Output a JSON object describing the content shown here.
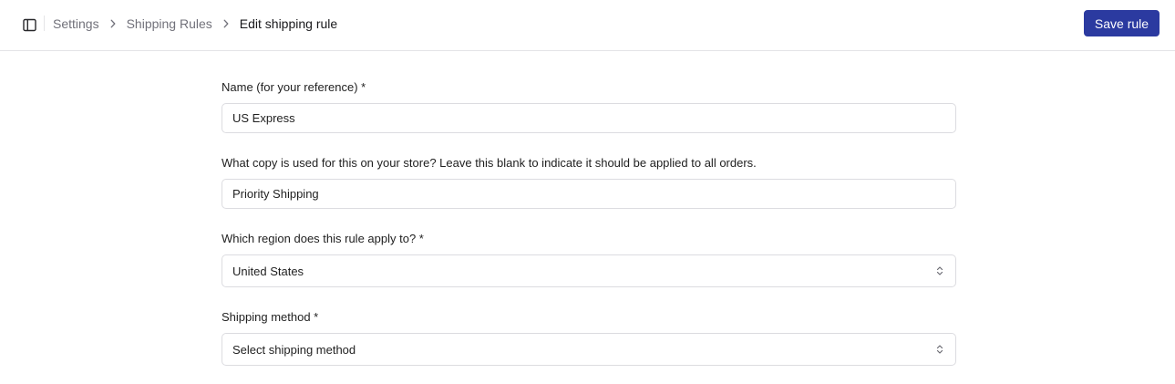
{
  "icons": {
    "sidebar_toggle": "sidebar-panel-icon",
    "breadcrumb_separator": "chevron-right-icon",
    "select_indicator": "chevron-up-down-icon"
  },
  "colors": {
    "primary": "#2b3aa0",
    "border": "#dcdce0",
    "muted_text": "#71717a"
  },
  "breadcrumb": {
    "items": [
      "Settings",
      "Shipping Rules"
    ],
    "current": "Edit shipping rule"
  },
  "header": {
    "save_label": "Save rule"
  },
  "form": {
    "name": {
      "label": "Name (for your reference) *",
      "value": "US Express"
    },
    "copy": {
      "label": "What copy is used for this on your store? Leave this blank to indicate it should be applied to all orders.",
      "value": "Priority Shipping"
    },
    "region": {
      "label": "Which region does this rule apply to? *",
      "value": "United States"
    },
    "method": {
      "label": "Shipping method *",
      "value": "Select shipping method"
    }
  }
}
